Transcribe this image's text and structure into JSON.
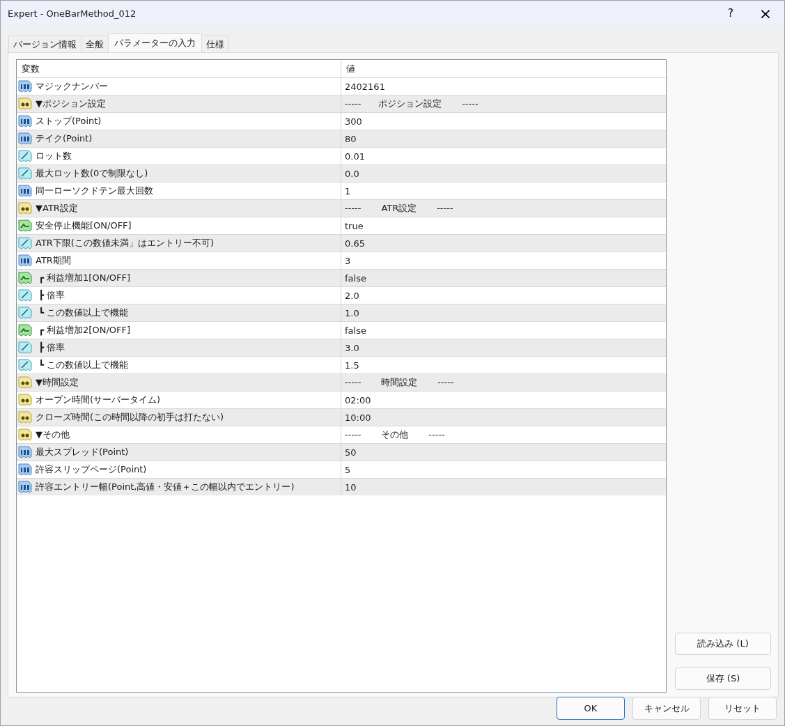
{
  "window": {
    "title": "Expert - OneBarMethod_012",
    "help": "?",
    "close": "×"
  },
  "tabs": [
    {
      "label": "バージョン情報",
      "selected": false
    },
    {
      "label": "全般",
      "selected": false
    },
    {
      "label": "パラメーターの入力",
      "selected": true
    },
    {
      "label": "仕様",
      "selected": false
    }
  ],
  "table": {
    "columns": [
      "変数",
      "値"
    ],
    "rows": [
      {
        "kind": "int",
        "name": "マジックナンバー",
        "value": "2402161"
      },
      {
        "kind": "string",
        "name": "▼ポジション設定",
        "value": "-----      ポジション設定       -----"
      },
      {
        "kind": "int",
        "name": "ストップ(Point)",
        "value": "300"
      },
      {
        "kind": "int",
        "name": "テイク(Point)",
        "value": "80"
      },
      {
        "kind": "double",
        "name": "ロット数",
        "value": "0.01"
      },
      {
        "kind": "double",
        "name": "最大ロット数(0で制限なし)",
        "value": "0.0"
      },
      {
        "kind": "int",
        "name": "同一ローソクドテン最大回数",
        "value": "1"
      },
      {
        "kind": "string",
        "name": "▼ATR設定",
        "value": "-----       ATR設定       -----"
      },
      {
        "kind": "bool",
        "name": "安全停止機能[ON/OFF]",
        "value": "true"
      },
      {
        "kind": "double",
        "name": "ATR下限(この数値未満」はエントリー不可)",
        "value": "0.65"
      },
      {
        "kind": "int",
        "name": "ATR期間",
        "value": "3"
      },
      {
        "kind": "bool",
        "name": " ┏ 利益増加1[ON/OFF]",
        "value": "false"
      },
      {
        "kind": "double",
        "name": " ┣ 倍率",
        "value": "2.0"
      },
      {
        "kind": "double",
        "name": " ┗ この数値以上で機能",
        "value": "1.0"
      },
      {
        "kind": "bool",
        "name": " ┏ 利益増加2[ON/OFF]",
        "value": "false"
      },
      {
        "kind": "double",
        "name": " ┣ 倍率",
        "value": "3.0"
      },
      {
        "kind": "double",
        "name": " ┗ この数値以上で機能",
        "value": "1.5"
      },
      {
        "kind": "string",
        "name": "▼時間設定",
        "value": "-----       時間設定       -----"
      },
      {
        "kind": "string",
        "name": "オープン時間(サーバータイム)",
        "value": "02:00"
      },
      {
        "kind": "string",
        "name": "クローズ時間(この時間以降の初手は打たない)",
        "value": "10:00"
      },
      {
        "kind": "string",
        "name": "▼その他",
        "value": "-----       その他       -----"
      },
      {
        "kind": "int",
        "name": "最大スプレッド(Point)",
        "value": "50"
      },
      {
        "kind": "int",
        "name": "許容スリップページ(Point)",
        "value": "5"
      },
      {
        "kind": "int",
        "name": "許容エントリー幅(Point,高値・安値＋この幅以内でエントリー)",
        "value": "10"
      }
    ]
  },
  "side_buttons": [
    "読み込み (L)",
    "保存 (S)"
  ],
  "buttons": [
    "OK",
    "キャンセル",
    "リセット"
  ]
}
